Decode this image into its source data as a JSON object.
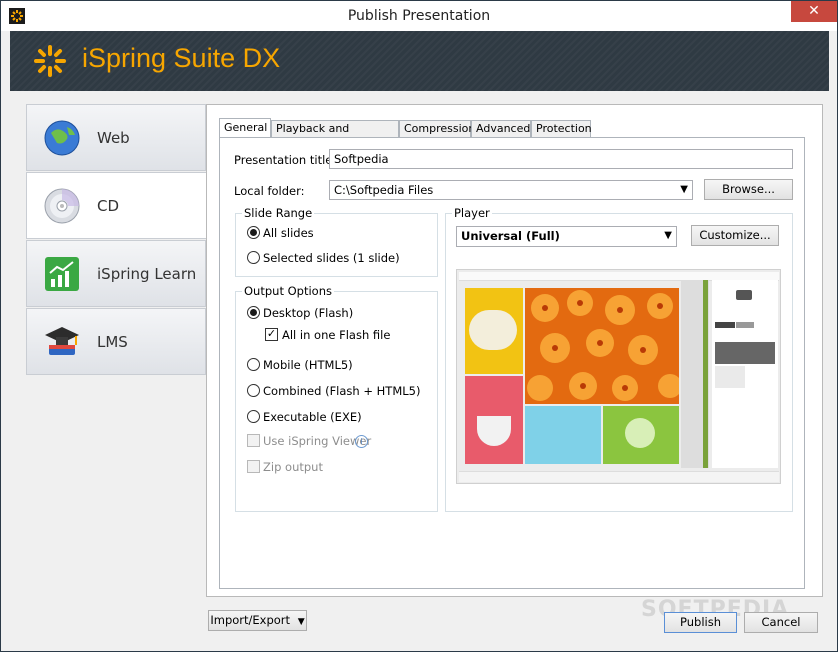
{
  "window": {
    "title": "Publish Presentation"
  },
  "banner": {
    "brand": "iSpring Suite DX"
  },
  "nav": {
    "items": [
      {
        "label": "Web",
        "icon": "globe-icon"
      },
      {
        "label": "CD",
        "icon": "cd-icon"
      },
      {
        "label": "iSpring Learn",
        "icon": "chart-icon"
      },
      {
        "label": "LMS",
        "icon": "graduation-cap-icon"
      }
    ],
    "active": "CD"
  },
  "tabs": [
    "General",
    "Playback and Navigation",
    "Compression",
    "Advanced",
    "Protection"
  ],
  "general": {
    "title_label": "Presentation title:",
    "title_value": "Softpedia",
    "folder_label": "Local folder:",
    "folder_value": "C:\\Softpedia Files",
    "browse": "Browse...",
    "slide_range": {
      "legend": "Slide Range",
      "all": "All slides",
      "selected": "Selected slides (1 slide)"
    },
    "output": {
      "legend": "Output Options",
      "desktop": "Desktop (Flash)",
      "all_in_one": "All in one Flash file",
      "mobile": "Mobile (HTML5)",
      "combined": "Combined (Flash + HTML5)",
      "exe": "Executable (EXE)",
      "viewer": "Use iSpring Viewer",
      "zip": "Zip output"
    },
    "player": {
      "legend": "Player",
      "value": "Universal (Full)",
      "customize": "Customize..."
    }
  },
  "footer": {
    "import_export": "Import/Export",
    "publish": "Publish",
    "cancel": "Cancel",
    "watermark": "SOFTPEDIA"
  },
  "colors": {
    "brand": "#f7a600",
    "banner": "#2f3a43",
    "close": "#c7483e"
  }
}
